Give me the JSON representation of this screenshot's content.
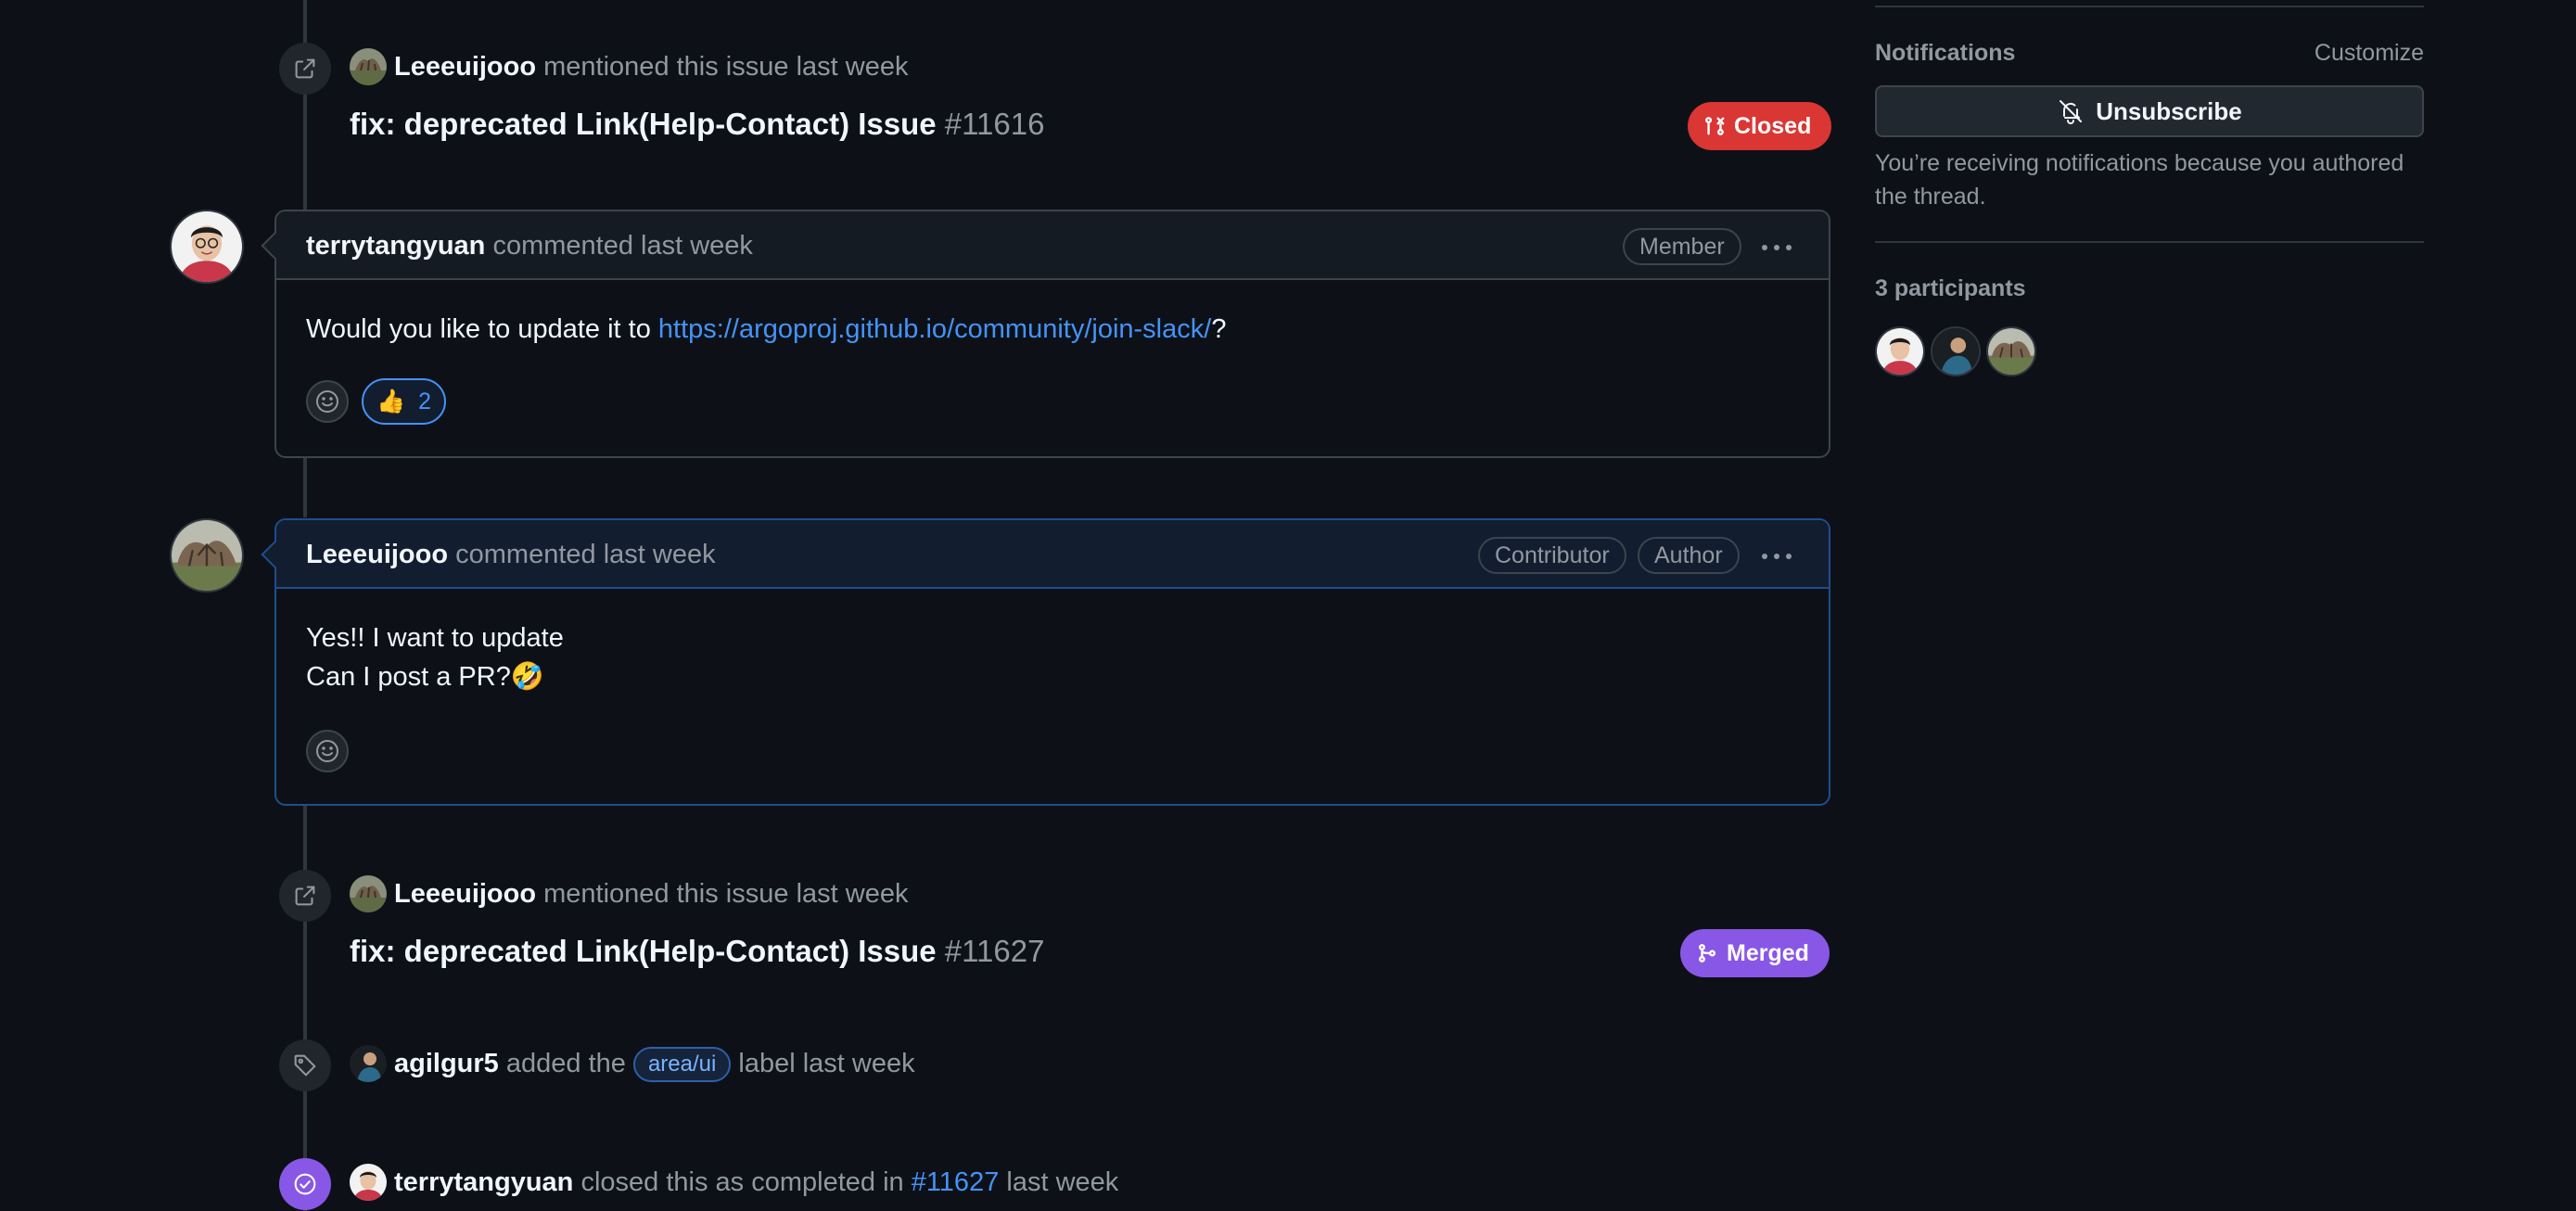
{
  "timeline": {
    "mention1": {
      "user": "Leeeuijooo",
      "action": "mentioned this issue",
      "time": "last week",
      "ref_title": "fix: deprecated Link(Help-Contact) Issue",
      "ref_number": "#11616",
      "state": "Closed"
    },
    "comment1": {
      "user": "terrytangyuan",
      "action": "commented",
      "time": "last week",
      "roles": [
        "Member"
      ],
      "body_prefix": "Would you like to update it to ",
      "body_link": "https://argoproj.github.io/community/join-slack/",
      "body_suffix": "?",
      "reactions": [
        {
          "emoji": "👍",
          "count": "2"
        }
      ]
    },
    "comment2": {
      "user": "Leeeuijooo",
      "action": "commented",
      "time": "last week",
      "roles": [
        "Contributor",
        "Author"
      ],
      "body_line1": "Yes!! I want to update",
      "body_line2": "Can I post a PR?🤣"
    },
    "mention2": {
      "user": "Leeeuijooo",
      "action": "mentioned this issue",
      "time": "last week",
      "ref_title": "fix: deprecated Link(Help-Contact) Issue",
      "ref_number": "#11627",
      "state": "Merged"
    },
    "label_event": {
      "user": "agilgur5",
      "action_prefix": "added the",
      "label": "area/ui",
      "action_suffix": "label last week"
    },
    "closed_event": {
      "user": "terrytangyuan",
      "action": "closed this as completed in",
      "ref": "#11627",
      "time": "last week"
    }
  },
  "sidebar": {
    "notifications_title": "Notifications",
    "customize_label": "Customize",
    "unsubscribe_label": "Unsubscribe",
    "notification_reason_line1": "You’re receiving notifications because you authored",
    "notification_reason_line2": "the thread.",
    "participants_title": "3 participants"
  },
  "colors": {
    "background": "#0d1117",
    "closed": "#da3633",
    "merged": "#8957e5",
    "link": "#4493f8"
  }
}
